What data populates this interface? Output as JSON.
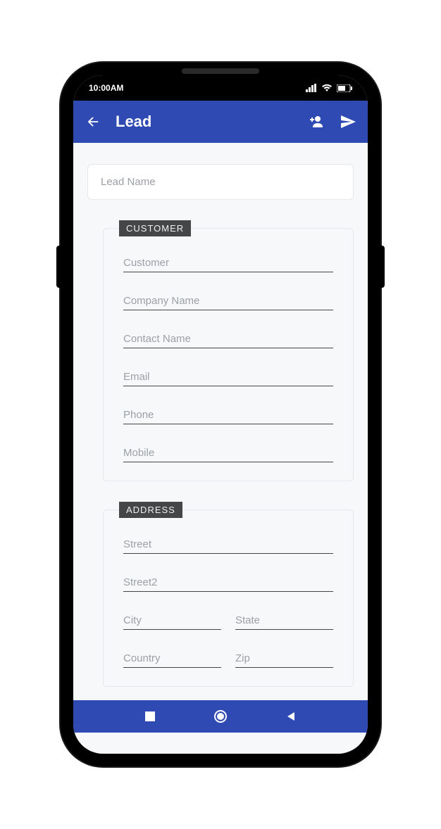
{
  "status": {
    "time": "10:00AM"
  },
  "appbar": {
    "title": "Lead"
  },
  "lead": {
    "name_placeholder": "Lead Name"
  },
  "customer": {
    "legend": "CUSTOMER",
    "fields": {
      "customer": "Customer",
      "company": "Company Name",
      "contact": "Contact Name",
      "email": "Email",
      "phone": "Phone",
      "mobile": "Mobile"
    }
  },
  "address": {
    "legend": "ADDRESS",
    "fields": {
      "street": "Street",
      "street2": "Street2",
      "city": "City",
      "state": "State",
      "country": "Country",
      "zip": "Zip"
    }
  }
}
